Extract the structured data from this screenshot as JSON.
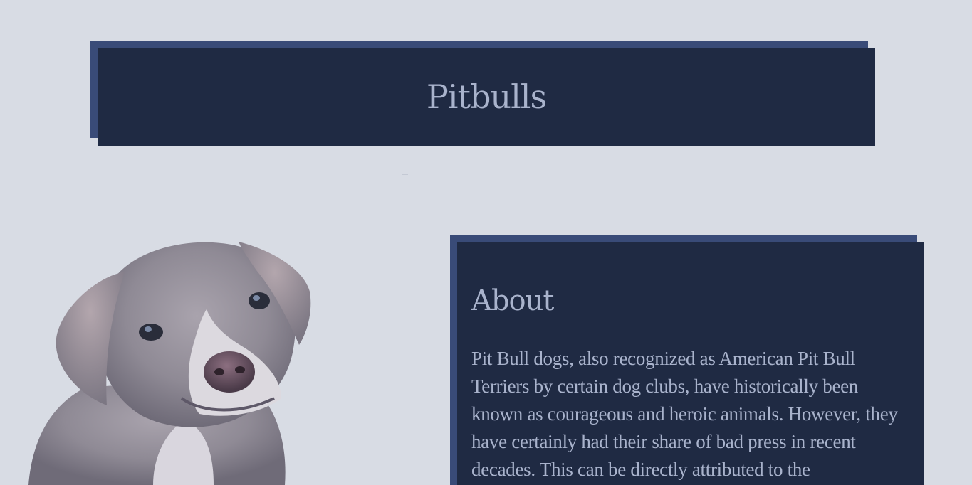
{
  "header": {
    "title": "Pitbulls"
  },
  "hero_image": {
    "icon": "pitbull-puppy-image"
  },
  "about": {
    "heading": "About",
    "text": "Pit Bull dogs, also recognized as American Pit Bull Terriers by certain dog clubs, have historically been known as courageous and heroic animals. However, they have certainly had their share of bad press in recent decades. This can be directly attributed to the"
  },
  "colors": {
    "background": "#d8dce4",
    "panel": "#1f2a43",
    "panel_shadow": "#394b78",
    "text": "#a9b3cc"
  }
}
